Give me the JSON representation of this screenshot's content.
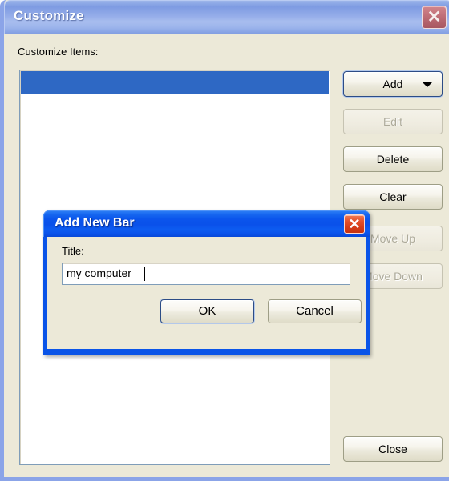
{
  "window": {
    "title": "Customize",
    "close_icon": "close-icon",
    "close_glyph": "✕",
    "accent_titlebar": "#8ba4e8",
    "background": "#ece9d8"
  },
  "main": {
    "items_label": "Customize Items:",
    "listbox": {
      "rows": [
        {
          "label": "",
          "selected": true
        }
      ],
      "selection_color": "#2e68c4",
      "background": "#ffffff"
    },
    "buttons": [
      {
        "label": "Add",
        "enabled": true,
        "default": true,
        "has_dropdown": true,
        "name": "add-button"
      },
      {
        "label": "Edit",
        "enabled": false,
        "default": false,
        "has_dropdown": false,
        "name": "edit-button"
      },
      {
        "label": "Delete",
        "enabled": true,
        "default": false,
        "has_dropdown": false,
        "name": "delete-button"
      },
      {
        "label": "Clear",
        "enabled": true,
        "default": false,
        "has_dropdown": false,
        "name": "clear-button"
      },
      {
        "label": "Move Up",
        "enabled": false,
        "default": false,
        "has_dropdown": false,
        "name": "move-up-button"
      },
      {
        "label": "Move Down",
        "enabled": false,
        "default": false,
        "has_dropdown": false,
        "name": "move-down-button"
      },
      {
        "label": "Close",
        "enabled": true,
        "default": false,
        "has_dropdown": false,
        "name": "close-button"
      }
    ]
  },
  "subdialog": {
    "title": "Add New Bar",
    "close_icon": "close-icon",
    "close_glyph": "✕",
    "accent_titlebar": "#0a54e8",
    "field": {
      "label": "Title:",
      "value": "my computer",
      "placeholder": "",
      "focused": true,
      "caret_visible": true
    },
    "ok_label": "OK",
    "cancel_label": "Cancel"
  }
}
